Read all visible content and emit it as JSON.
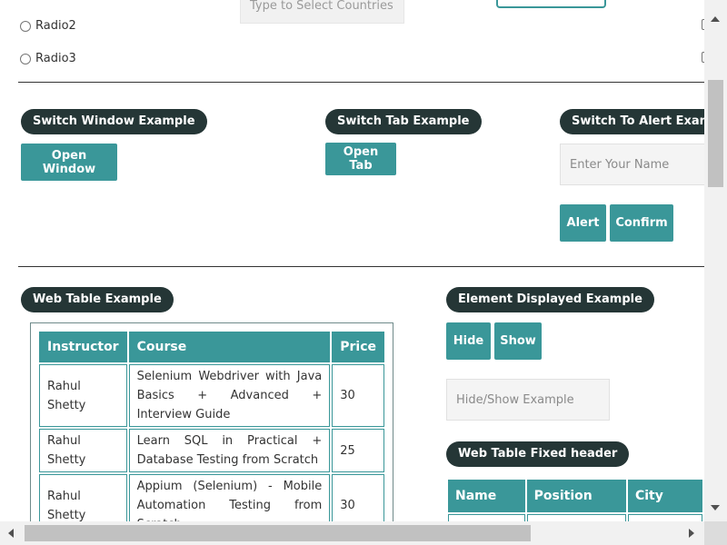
{
  "radio": {
    "items": [
      {
        "label": "Radio2"
      },
      {
        "label": "Radio3"
      }
    ]
  },
  "autocomplete": {
    "placeholder": "Type to Select Countries"
  },
  "switch_window": {
    "legend": "Switch Window Example",
    "open_window": "Open Window"
  },
  "switch_tab": {
    "legend": "Switch Tab Example",
    "open_tab": "Open Tab"
  },
  "alert": {
    "legend": "Switch To Alert Example",
    "name_placeholder": "Enter Your Name",
    "alert_button": "Alert",
    "confirm_button": "Confirm"
  },
  "web_table": {
    "legend": "Web Table Example",
    "headers": [
      "Instructor",
      "Course",
      "Price"
    ],
    "rows": [
      [
        "Rahul Shetty",
        "Selenium Webdriver with Java Basics + Advanced + Interview Guide",
        "30"
      ],
      [
        "Rahul Shetty",
        "Learn SQL in Practical + Database Testing from Scratch",
        "25"
      ],
      [
        "Rahul Shetty",
        "Appium (Selenium) - Mobile Automation Testing from Scratch",
        "30"
      ]
    ]
  },
  "element_displayed": {
    "legend": "Element Displayed Example",
    "hide_button": "Hide",
    "show_button": "Show",
    "placeholder": "Hide/Show Example"
  },
  "fixed_table": {
    "legend": "Web Table Fixed header",
    "headers": [
      "Name",
      "Position",
      "City"
    ]
  },
  "colors": {
    "accent": "#3a9799",
    "legend_bg": "#253636"
  }
}
